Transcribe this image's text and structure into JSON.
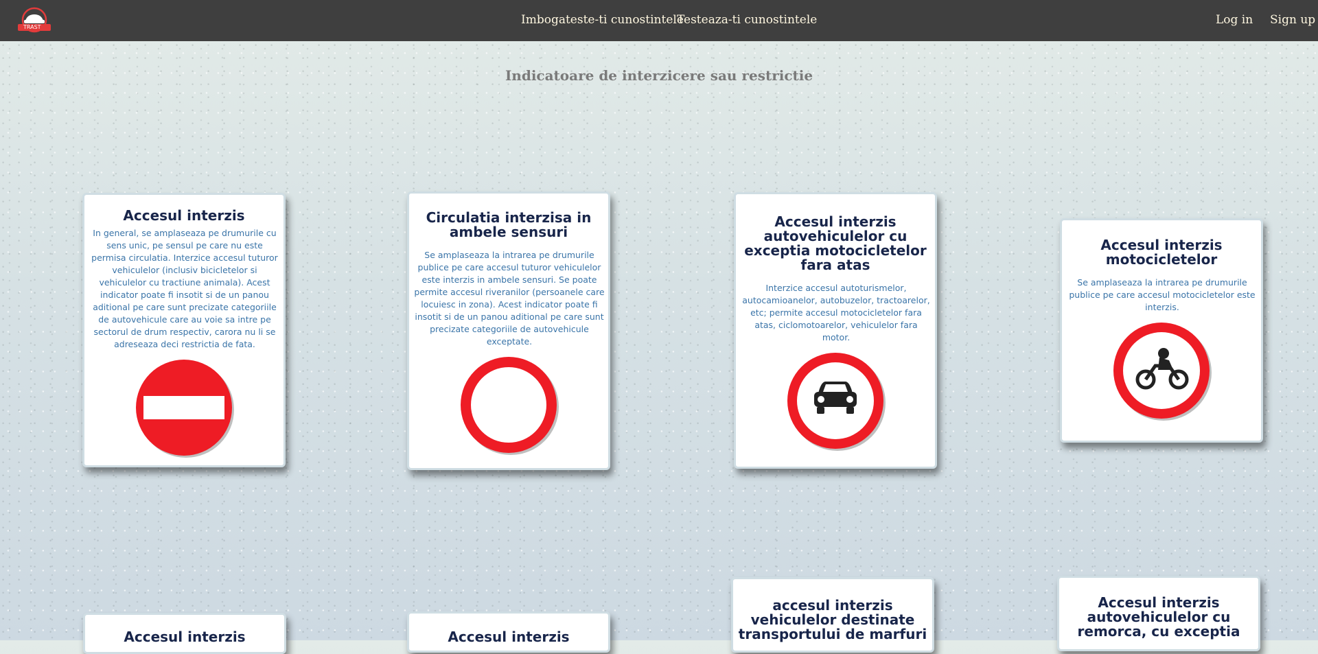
{
  "header": {
    "logo_text": "TRAST",
    "nav": [
      "Imbogateste-ti cunostintele",
      "Testeaza-ti cunostintele"
    ],
    "login": "Log in",
    "signup": "Sign up"
  },
  "page": {
    "title": "Indicatoare de interzicere sau restrictie"
  },
  "cards": [
    {
      "title": "Accesul interzis",
      "text": "In general, se amplaseaza pe drumurile cu sens unic, pe sensul pe care nu este permisa circulatia. Interzice accesul tuturor vehiculelor (inclusiv bicicletelor si vehiculelor cu tractiune animala). Acest indicator poate fi insotit si de un panou aditional pe care sunt precizate categoriile de autovehicule care au voie sa intre pe sectorul de drum respectiv, carora nu li se adreseaza deci restrictia de fata.",
      "icon": "no-entry-sign-icon"
    },
    {
      "title": "Circulatia interzisa in ambele sensuri",
      "text": "Se amplaseaza la intrarea pe drumurile publice pe care accesul tuturor vehiculelor este interzis in ambele sensuri. Se poate permite accesul riveranilor (persoanele care locuiesc in zona). Acest indicator poate fi insotit si de un panou aditional pe care sunt precizate categoriile de autovehicule exceptate.",
      "icon": "no-vehicles-sign-icon"
    },
    {
      "title": "Accesul interzis autovehiculelor cu exceptia motocicletelor fara atas",
      "text": "Interzice accesul autoturismelor, autocamioanelor, autobuzelor, tractoarelor, etc; permite accesul motocicletelor fara atas, ciclomotoarelor, vehiculelor fara motor.",
      "icon": "no-cars-sign-icon"
    },
    {
      "title": "Accesul interzis motocicletelor",
      "text": "Se amplaseaza la intrarea pe drumurile publice pe care accesul motocicletelor este interzis.",
      "icon": "no-motorcycles-sign-icon"
    }
  ],
  "cards_lower": [
    {
      "title": "Accesul interzis"
    },
    {
      "title": "Accesul interzis"
    },
    {
      "title": "accesul interzis vehiculelor destinate transportului de marfuri"
    },
    {
      "title": "Accesul interzis autovehiculelor cu remorca, cu exceptia"
    }
  ],
  "colors": {
    "topbar": "#3f3f3f",
    "sign_red": "#ee1c25",
    "card_title": "#18254a",
    "card_text": "#3a74a8",
    "nav_text": "#fff7e0"
  }
}
